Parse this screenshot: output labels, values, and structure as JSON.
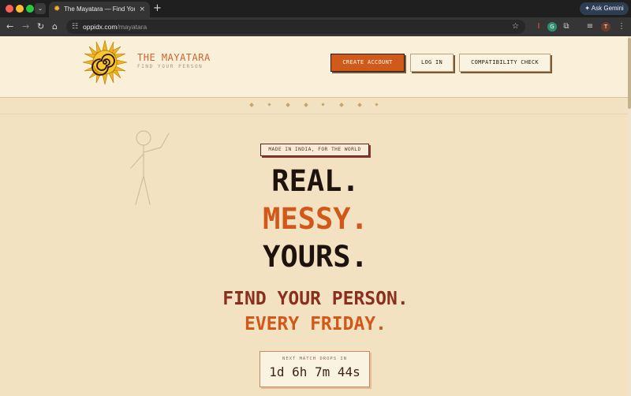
{
  "browser": {
    "tab_title": "The Mayatara — Find Your Person",
    "tab_close": "×",
    "new_tab": "+",
    "ask_gemini": "Ask Gemini",
    "url_host": "oppidx.com",
    "url_path": "/mayatara"
  },
  "header": {
    "brand_name": "THE MAYATARA",
    "brand_tagline": "FIND YOUR PERSON",
    "buttons": {
      "create_account": "CREATE ACCOUNT",
      "log_in": "LOG IN",
      "compatibility": "COMPATIBILITY CHECK"
    }
  },
  "hero": {
    "badge": "MADE IN INDIA, FOR THE WORLD",
    "headline_1": "REAL.",
    "headline_2": "MESSY.",
    "headline_3": "YOURS.",
    "sub_1": "FIND YOUR PERSON.",
    "sub_2": "EVERY FRIDAY.",
    "countdown_label": "NEXT MATCH DROPS IN",
    "countdown_value": "1d 6h 7m 44s"
  },
  "colors": {
    "accent": "#d05a1a",
    "dark_red": "#8a2e1e",
    "ink": "#1e120c",
    "cream": "#f3e2c1"
  }
}
